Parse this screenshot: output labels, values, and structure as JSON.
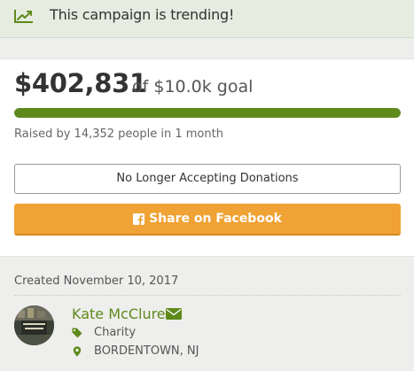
{
  "trending": {
    "icon": "trending-up-icon",
    "text": "This campaign is trending!"
  },
  "progress": {
    "amount_raised": "$402,831",
    "goal_text": "of $10.0k goal",
    "percent_funded": 100,
    "bar_color": "#5e8a1b",
    "raised_by_text": "Raised by 14,352 people in 1 month"
  },
  "actions": {
    "no_donations_label": "No Longer Accepting Donations",
    "share_facebook_label": "Share on Facebook",
    "share_color": "#f0a234"
  },
  "organizer": {
    "created_text": "Created November 10, 2017",
    "name": "Kate McClure",
    "category": "Charity",
    "location": "BORDENTOWN, NJ",
    "name_color": "#5e8a1b"
  }
}
